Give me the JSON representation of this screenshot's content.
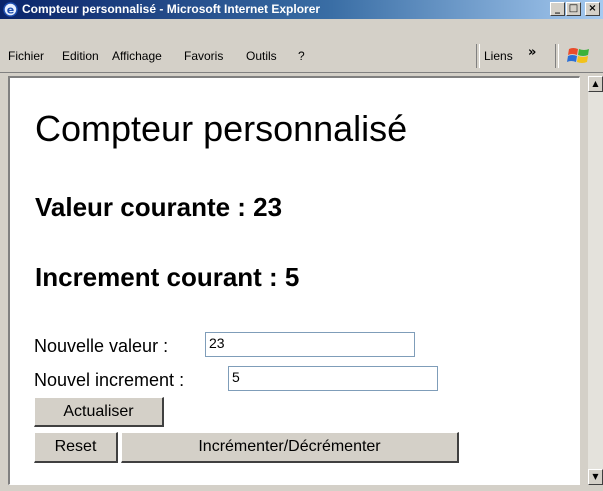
{
  "window": {
    "title": "Compteur personnalisé - Microsoft Internet Explorer",
    "title_bar_gradient": [
      "#0a246a",
      "#3a6ea5",
      "#a6caf0"
    ],
    "minimize_glyph": "_",
    "maximize_glyph": "□",
    "close_glyph": "×"
  },
  "menubar": {
    "items": [
      "Fichier",
      "Edition",
      "Affichage",
      "Favoris",
      "Outils",
      "?"
    ],
    "links_label": "Liens",
    "chevron": "»"
  },
  "page": {
    "title": "Compteur personnalisé",
    "current_value_label": "Valeur courante : 23",
    "current_increment_label": "Increment courant : 5",
    "form": {
      "new_value_label": "Nouvelle valeur :",
      "new_value": "23",
      "new_increment_label": "Nouvel increment :",
      "new_increment": "5",
      "update_button": "Actualiser",
      "reset_button": "Reset",
      "increment_button": "Incrémenter/Décrémenter"
    }
  },
  "scrollbar": {
    "up_glyph": "▲",
    "down_glyph": "▼"
  }
}
